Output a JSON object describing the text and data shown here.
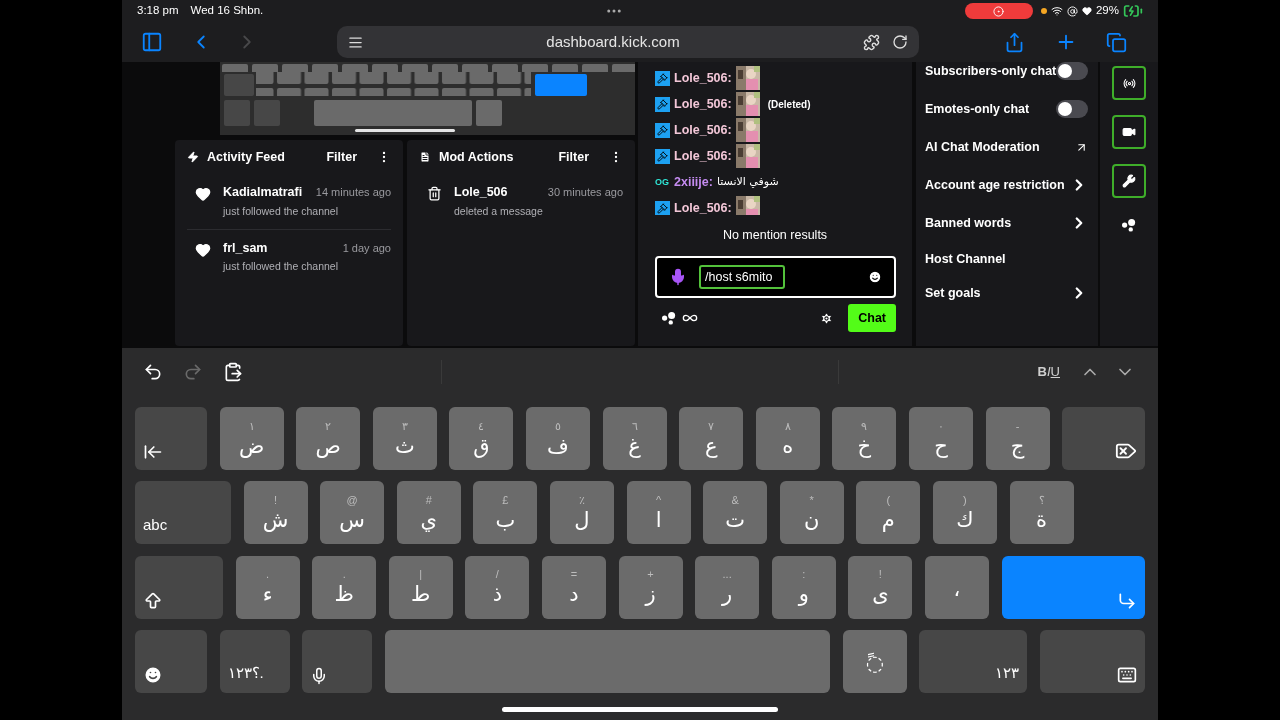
{
  "status_bar": {
    "time": "3:18 pm",
    "date": "Wed 16 Shbn.",
    "battery": "29%"
  },
  "browser": {
    "url": "dashboard.kick.com",
    "forward_disabled": true
  },
  "activity_feed": {
    "title": "Activity Feed",
    "filter": "Filter",
    "items": [
      {
        "name": "Kadialmatrafi",
        "time": "14 minutes ago",
        "text": "just followed the channel"
      },
      {
        "name": "frl_sam",
        "time": "1 day ago",
        "text": "just followed the channel"
      }
    ]
  },
  "mod_actions": {
    "title": "Mod Actions",
    "filter": "Filter",
    "items": [
      {
        "name": "Lole_506",
        "time": "30 minutes ago",
        "text": "deleted a message"
      }
    ]
  },
  "chat": {
    "messages": [
      {
        "badge": {
          "kind": "mod"
        },
        "user": "Lole_506:",
        "color": "#f3c7d8",
        "kind": "emote"
      },
      {
        "badge": {
          "kind": "mod"
        },
        "user": "Lole_506:",
        "color": "#f3c7d8",
        "kind": "emote",
        "note": "(Deleted)"
      },
      {
        "badge": {
          "kind": "mod"
        },
        "user": "Lole_506:",
        "color": "#f3c7d8",
        "kind": "emote"
      },
      {
        "badge": {
          "kind": "mod"
        },
        "user": "Lole_506:",
        "color": "#f3c7d8",
        "kind": "emote"
      },
      {
        "badge": {
          "kind": "og",
          "label": "OG"
        },
        "user": "2xiiije:",
        "color": "#c48bf0",
        "kind": "text",
        "text": "شوفي الانستا"
      },
      {
        "badge": {
          "kind": "mod"
        },
        "user": "Lole_506:",
        "color": "#f3c7d8",
        "kind": "emote"
      }
    ],
    "notice": "No mention results",
    "input": {
      "value": "/host s6mito"
    },
    "send": "Chat"
  },
  "settings": {
    "items": [
      {
        "kind": "toggle",
        "label": "Subscribers-only chat",
        "on": false
      },
      {
        "kind": "toggle",
        "label": "Emotes-only chat",
        "on": false
      },
      {
        "kind": "external",
        "label": "AI Chat Moderation"
      },
      {
        "kind": "submenu",
        "label": "Account age restriction"
      },
      {
        "kind": "submenu",
        "label": "Banned words"
      },
      {
        "kind": "action",
        "label": "Host Channel"
      },
      {
        "kind": "submenu",
        "label": "Set goals"
      }
    ]
  },
  "keyboard": {
    "redo_disabled": true,
    "format": [
      "B",
      "I",
      "U"
    ],
    "rows": [
      [
        {
          "kind": "tab"
        },
        {
          "kind": "letter",
          "main": "ض",
          "alt": "١"
        },
        {
          "kind": "letter",
          "main": "ص",
          "alt": "٢"
        },
        {
          "kind": "letter",
          "main": "ث",
          "alt": "٣"
        },
        {
          "kind": "letter",
          "main": "ق",
          "alt": "٤"
        },
        {
          "kind": "letter",
          "main": "ف",
          "alt": "٥"
        },
        {
          "kind": "letter",
          "main": "غ",
          "alt": "٦"
        },
        {
          "kind": "letter",
          "main": "ع",
          "alt": "٧"
        },
        {
          "kind": "letter",
          "main": "ه",
          "alt": "٨"
        },
        {
          "kind": "letter",
          "main": "خ",
          "alt": "٩"
        },
        {
          "kind": "letter",
          "main": "ح",
          "alt": "٠"
        },
        {
          "kind": "letter",
          "main": "ج",
          "alt": "-"
        },
        {
          "kind": "delete"
        }
      ],
      [
        {
          "kind": "abc",
          "label": "abc"
        },
        {
          "kind": "letter",
          "main": "ش",
          "alt": "!"
        },
        {
          "kind": "letter",
          "main": "س",
          "alt": "@"
        },
        {
          "kind": "letter",
          "main": "ي",
          "alt": "#"
        },
        {
          "kind": "letter",
          "main": "ب",
          "alt": "£"
        },
        {
          "kind": "letter",
          "main": "ل",
          "alt": "٪"
        },
        {
          "kind": "letter",
          "main": "ا",
          "alt": "^"
        },
        {
          "kind": "letter",
          "main": "ت",
          "alt": "&"
        },
        {
          "kind": "letter",
          "main": "ن",
          "alt": "*"
        },
        {
          "kind": "letter",
          "main": "م",
          "alt": "("
        },
        {
          "kind": "letter",
          "main": "ك",
          "alt": ")"
        },
        {
          "kind": "letter",
          "main": "ة",
          "alt": "؟"
        }
      ],
      [
        {
          "kind": "shift"
        },
        {
          "kind": "letter",
          "main": "ء",
          "alt": "."
        },
        {
          "kind": "letter",
          "main": "ظ",
          "alt": "."
        },
        {
          "kind": "letter",
          "main": "ط",
          "alt": "|"
        },
        {
          "kind": "letter",
          "main": "ذ",
          "alt": "/"
        },
        {
          "kind": "letter",
          "main": "د",
          "alt": "="
        },
        {
          "kind": "letter",
          "main": "ز",
          "alt": "+"
        },
        {
          "kind": "letter",
          "main": "ر",
          "alt": "..."
        },
        {
          "kind": "letter",
          "main": "و",
          "alt": ":"
        },
        {
          "kind": "letter",
          "main": "ى",
          "alt": "!"
        },
        {
          "kind": "letter",
          "main": "،"
        },
        {
          "kind": "return"
        }
      ],
      [
        {
          "kind": "emoji"
        },
        {
          "kind": "numbers",
          "label": "١٢٣؟."
        },
        {
          "kind": "mic"
        },
        {
          "kind": "space"
        },
        {
          "kind": "letter",
          "main": "◌ً"
        },
        {
          "kind": "numpad",
          "label": "١٢٣"
        },
        {
          "kind": "hide"
        }
      ]
    ]
  }
}
